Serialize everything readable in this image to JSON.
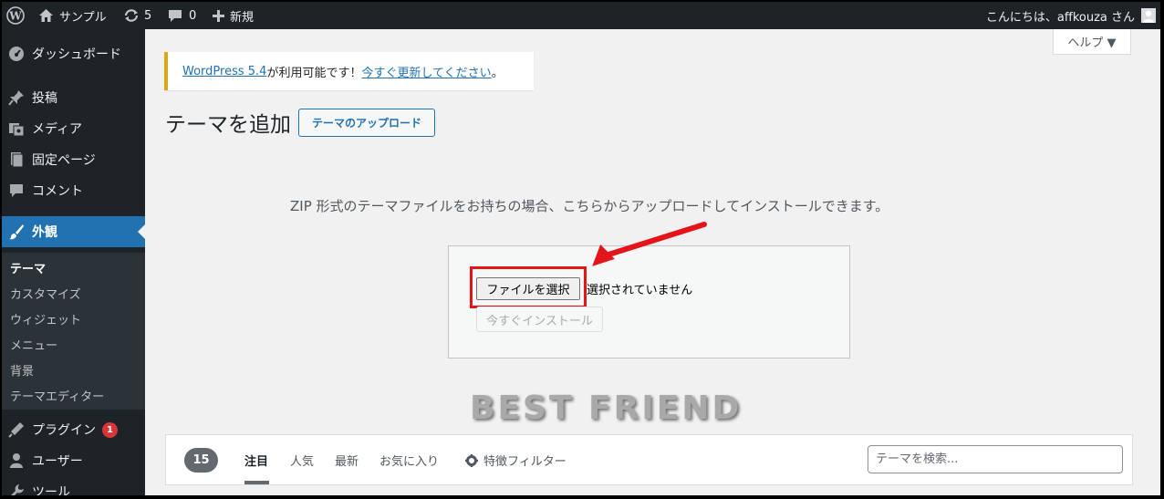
{
  "adminbar": {
    "site_name": "サンプル",
    "updates_count": "5",
    "comments_count": "0",
    "new_label": "新規",
    "greeting": "こんにちは、affkouza さん"
  },
  "sidebar": {
    "items": [
      {
        "label": "ダッシュボード",
        "icon": "dashboard-icon"
      },
      {
        "label": "投稿",
        "icon": "pin-icon"
      },
      {
        "label": "メディア",
        "icon": "media-icon"
      },
      {
        "label": "固定ページ",
        "icon": "page-icon"
      },
      {
        "label": "コメント",
        "icon": "comment-icon"
      },
      {
        "label": "外観",
        "icon": "brush-icon"
      },
      {
        "label": "プラグイン",
        "icon": "plugin-icon",
        "badge": "1"
      },
      {
        "label": "ユーザー",
        "icon": "user-icon"
      },
      {
        "label": "ツール",
        "icon": "wrench-icon"
      }
    ],
    "submenu": [
      "テーマ",
      "カスタマイズ",
      "ウィジェット",
      "メニュー",
      "背景",
      "テーマエディター"
    ]
  },
  "help_label": "ヘルプ ▼",
  "notice": {
    "link1": "WordPress 5.4",
    "middle": " が利用可能です！",
    "link2": "今すぐ更新してください",
    "end": "。"
  },
  "page_title": "テーマを追加",
  "upload_button": "テーマのアップロード",
  "description": "ZIP 形式のテーマファイルをお持ちの場合、こちらからアップロードしてインストールできます。",
  "upload": {
    "choose_file": "ファイルを選択",
    "no_file": "選択されていません",
    "install": "今すぐインストール"
  },
  "watermark": "BEST  FRIEND",
  "filter": {
    "count": "15",
    "tabs": [
      "注目",
      "人気",
      "最新",
      "お気に入り"
    ],
    "feature_filter": "特徴フィルター",
    "search_placeholder": "テーマを検索..."
  },
  "colors": {
    "accent": "#2271b1",
    "admin_bg": "#1d2327",
    "highlight": "#e3141a"
  }
}
